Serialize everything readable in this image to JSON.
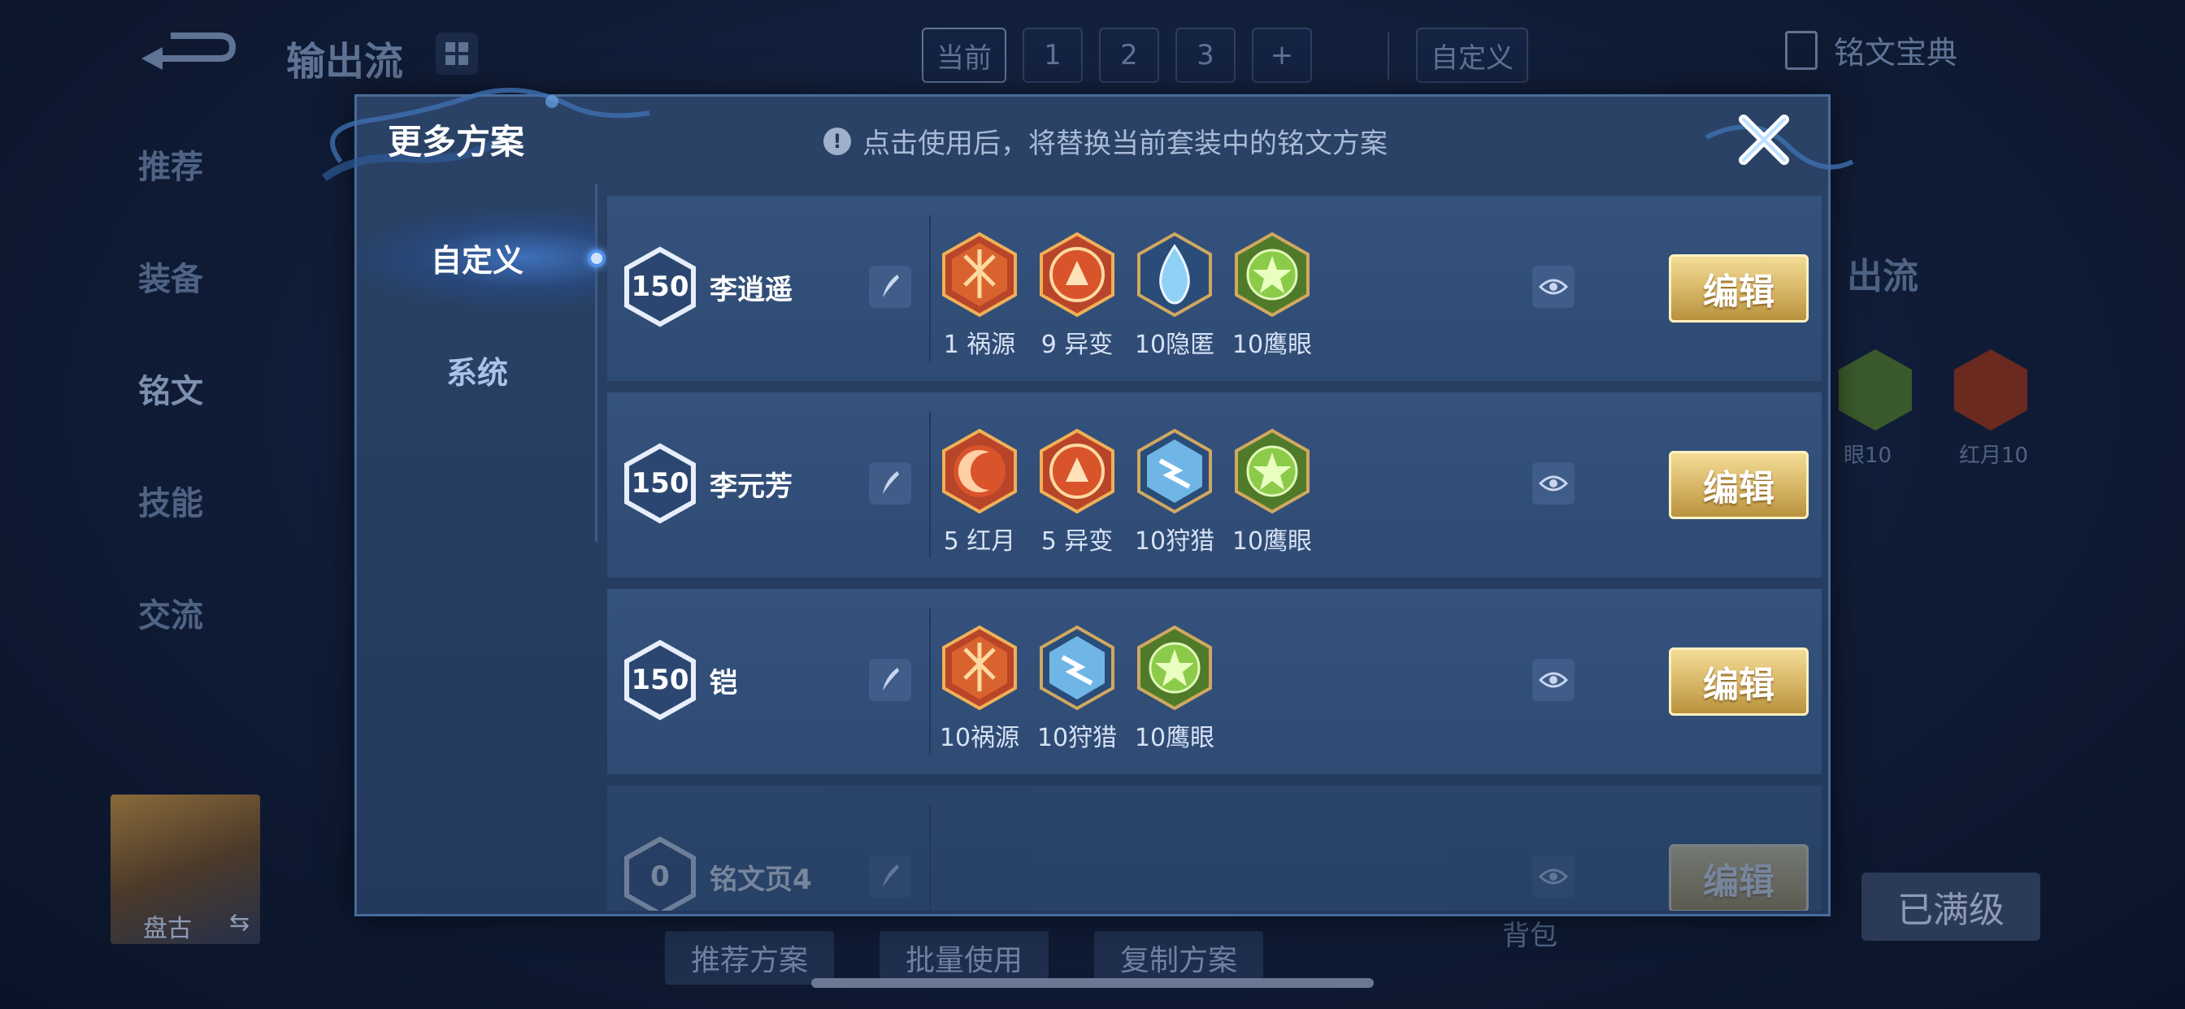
{
  "background": {
    "title": "输出流",
    "tabs": [
      "当前",
      "1",
      "2",
      "3",
      "+"
    ],
    "custom_tab": "自定义",
    "top_right_label": "铭文宝典",
    "side_menu": [
      "推荐",
      "装备",
      "铭文",
      "技能",
      "交流"
    ],
    "hero_name": "盘古",
    "hero_swap": "⇆",
    "bottom_buttons": [
      "推荐方案",
      "批量使用",
      "复制方案"
    ],
    "bag_label": "背包",
    "maxed_label": "已满级",
    "right_panel_title": "出流",
    "right_rune_labels": [
      "眼10",
      "红月10"
    ]
  },
  "modal": {
    "title": "更多方案",
    "hint_icon": "!",
    "hint": "点击使用后，将替换当前套装中的铭文方案",
    "tabs": [
      {
        "label": "自定义",
        "active": true
      },
      {
        "label": "系统",
        "active": false
      }
    ],
    "edit_label": "编辑",
    "plans": [
      {
        "level": "150",
        "name": "李逍遥",
        "runes": [
          {
            "label": "1 祸源",
            "icon": "huoyuan-rune-icon",
            "color": "#d9532b"
          },
          {
            "label": "9 异变",
            "icon": "yibian-rune-icon",
            "color": "#d9532b"
          },
          {
            "label": "10隐匿",
            "icon": "yinni-rune-icon",
            "color": "#6fb6e6"
          },
          {
            "label": "10鹰眼",
            "icon": "yingyan-rune-icon",
            "color": "#7dbb3e"
          }
        ]
      },
      {
        "level": "150",
        "name": "李元芳",
        "runes": [
          {
            "label": "5 红月",
            "icon": "hongyue-rune-icon",
            "color": "#d9532b"
          },
          {
            "label": "5 异变",
            "icon": "yibian-rune-icon",
            "color": "#d9532b"
          },
          {
            "label": "10狩猎",
            "icon": "shoulie-rune-icon",
            "color": "#6fb6e6"
          },
          {
            "label": "10鹰眼",
            "icon": "yingyan-rune-icon",
            "color": "#7dbb3e"
          }
        ]
      },
      {
        "level": "150",
        "name": "铠",
        "runes": [
          {
            "label": "10祸源",
            "icon": "huoyuan-rune-icon",
            "color": "#d9532b"
          },
          {
            "label": "10狩猎",
            "icon": "shoulie-rune-icon",
            "color": "#6fb6e6"
          },
          {
            "label": "10鹰眼",
            "icon": "yingyan-rune-icon",
            "color": "#7dbb3e"
          }
        ]
      },
      {
        "level": "0",
        "name": "铭文页4",
        "runes": []
      }
    ]
  },
  "colors": {
    "accent_gold": "#d6b464",
    "modal_bg": "#233a5e",
    "row_bg": "#34527c"
  }
}
